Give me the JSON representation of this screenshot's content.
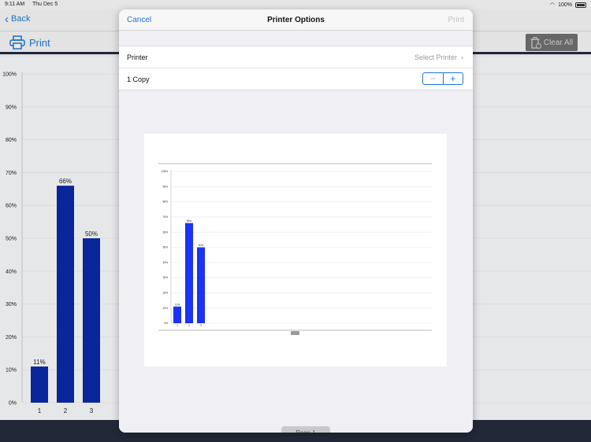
{
  "status_bar": {
    "time": "9:11 AM",
    "date": "Thu Dec 5",
    "battery": "100%"
  },
  "nav": {
    "back_label": "Back"
  },
  "toolbar": {
    "print_label": "Print",
    "clear_all_label": "Clear All"
  },
  "chart_data": {
    "type": "bar",
    "categories": [
      "1",
      "2",
      "3"
    ],
    "values": [
      11,
      66,
      50
    ],
    "value_labels": [
      "11%",
      "66%",
      "50%"
    ],
    "y_ticks": [
      "0%",
      "10%",
      "20%",
      "30%",
      "40%",
      "50%",
      "60%",
      "70%",
      "80%",
      "90%",
      "100%"
    ],
    "ylim": [
      0,
      100
    ],
    "color": "#0a2aa8",
    "grid": true
  },
  "modal": {
    "cancel_label": "Cancel",
    "title": "Printer Options",
    "print_label": "Print",
    "printer_label": "Printer",
    "printer_value": "Select Printer",
    "copies_label": "1 Copy",
    "stepper_minus": "−",
    "stepper_plus": "+",
    "preview_page_label": "Page 1",
    "preview_bar_color": "#1a33f5"
  }
}
